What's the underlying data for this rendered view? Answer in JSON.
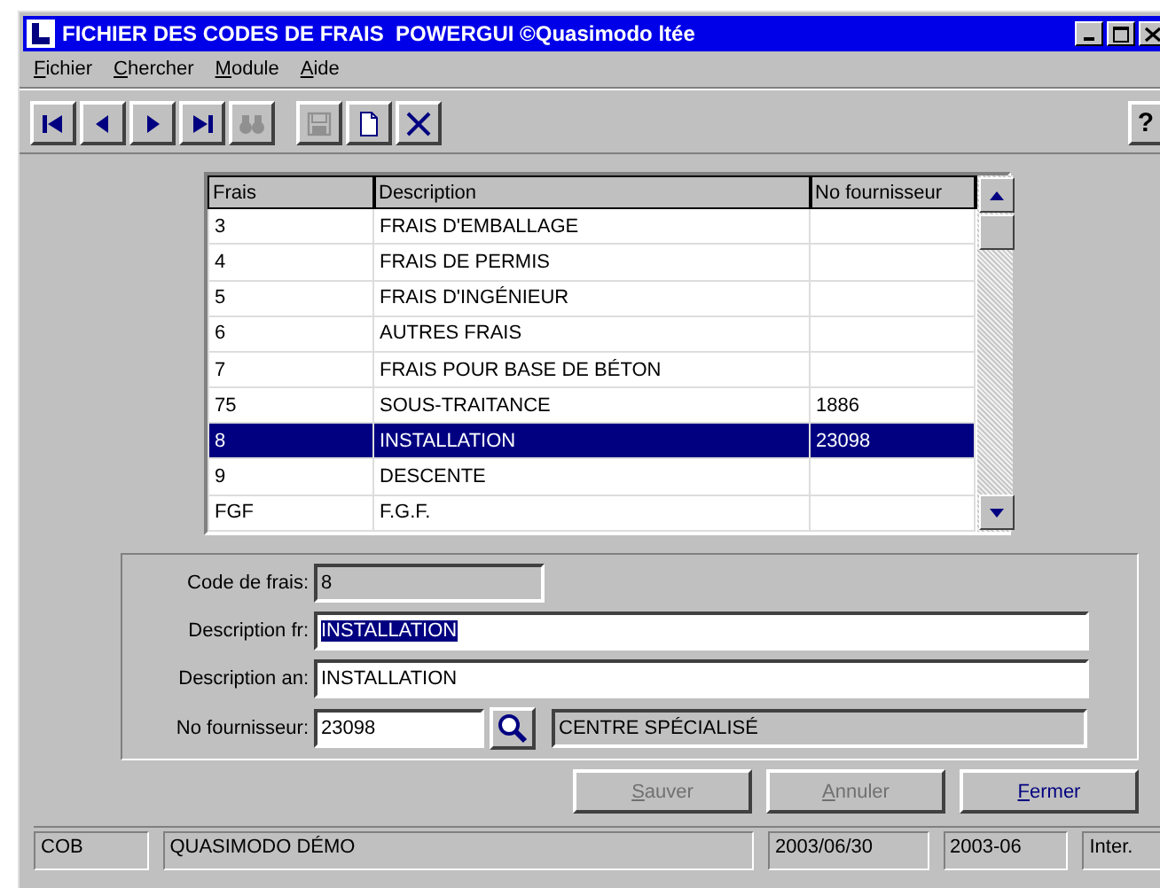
{
  "window": {
    "title": "FICHIER DES CODES DE FRAIS  POWERGUI ©Quasimodo ltée"
  },
  "menu": [
    "Fichier",
    "Chercher",
    "Module",
    "Aide"
  ],
  "toolbar": [
    {
      "kind": "first",
      "disabled": false
    },
    {
      "kind": "prev",
      "disabled": false
    },
    {
      "kind": "next",
      "disabled": false
    },
    {
      "kind": "last",
      "disabled": false
    },
    {
      "kind": "find",
      "disabled": true
    },
    {
      "kind": "save",
      "disabled": true
    },
    {
      "kind": "new",
      "disabled": false
    },
    {
      "kind": "delete",
      "disabled": false
    }
  ],
  "help_button": "?",
  "table": {
    "columns": [
      "Frais",
      "Description",
      "No fournisseur"
    ],
    "rows": [
      {
        "cells": [
          "3",
          "FRAIS D'EMBALLAGE",
          ""
        ],
        "selected": false
      },
      {
        "cells": [
          "4",
          "FRAIS DE PERMIS",
          ""
        ],
        "selected": false
      },
      {
        "cells": [
          "5",
          "FRAIS D'INGÉNIEUR",
          ""
        ],
        "selected": false
      },
      {
        "cells": [
          "6",
          "AUTRES FRAIS",
          ""
        ],
        "selected": false
      },
      {
        "cells": [
          "7",
          "FRAIS POUR BASE DE BÉTON",
          ""
        ],
        "selected": false
      },
      {
        "cells": [
          "75",
          "SOUS-TRAITANCE",
          "1886"
        ],
        "selected": false
      },
      {
        "cells": [
          "8",
          "INSTALLATION",
          "23098"
        ],
        "selected": true
      },
      {
        "cells": [
          "9",
          "DESCENTE",
          ""
        ],
        "selected": false
      },
      {
        "cells": [
          "FGF",
          "F.G.F.",
          ""
        ],
        "selected": false
      }
    ]
  },
  "form": {
    "code": {
      "label": "Code de frais:",
      "value": "8"
    },
    "description_fr": {
      "label": "Description fr:",
      "value": "INSTALLATION",
      "text_selected": true
    },
    "description_an": {
      "label": "Description an:",
      "value": "INSTALLATION",
      "text_selected": false
    },
    "supplier": {
      "label": "No fournisseur:",
      "value": "23098",
      "name": "CENTRE SPÉCIALISÉ"
    }
  },
  "buttons": [
    {
      "label": "Sauver",
      "disabled": true
    },
    {
      "label": "Annuler",
      "disabled": true
    },
    {
      "label": "Fermer",
      "disabled": false
    }
  ],
  "status_bar": [
    "COB",
    "QUASIMODO DÉMO",
    "2003/06/30",
    "2003-06",
    "Inter."
  ]
}
